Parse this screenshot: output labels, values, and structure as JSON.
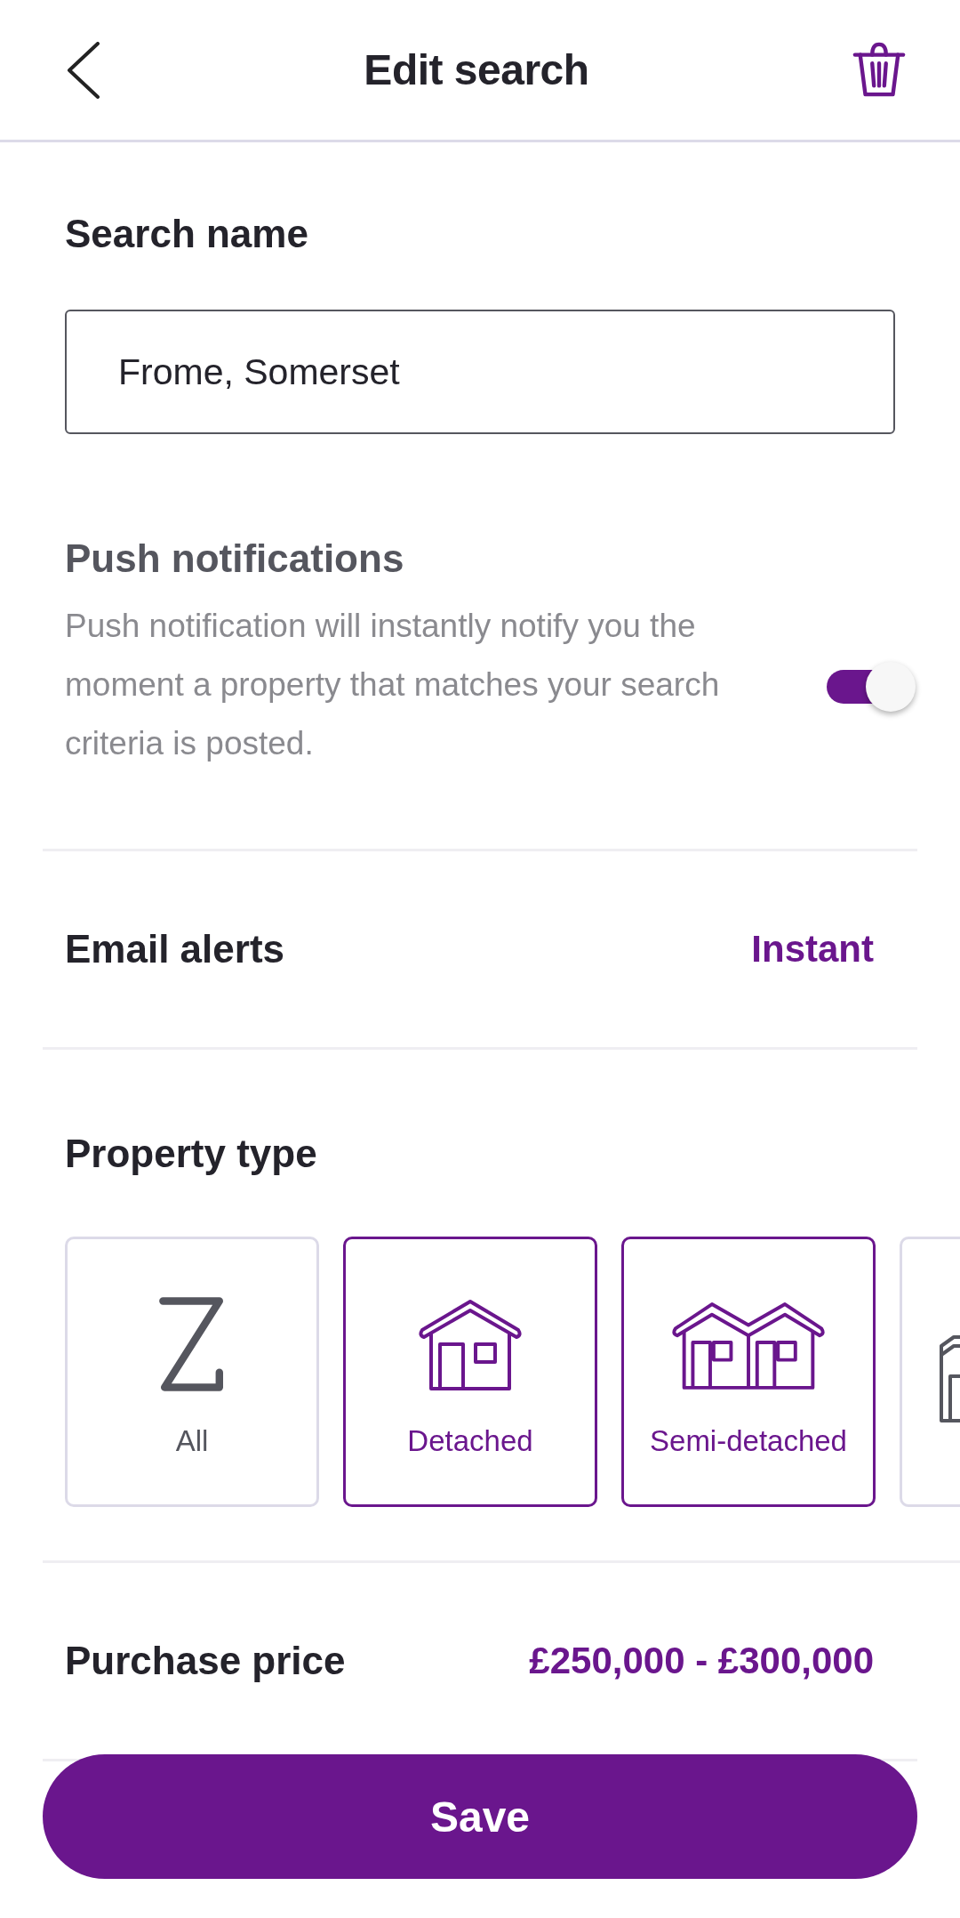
{
  "header": {
    "title": "Edit search"
  },
  "search_name": {
    "label": "Search name",
    "value": "Frome, Somerset"
  },
  "push_notifications": {
    "label": "Push notifications",
    "description": "Push notification will instantly notify you the moment a property that matches your search criteria is posted.",
    "on": true
  },
  "email_alerts": {
    "label": "Email alerts",
    "value": "Instant"
  },
  "property_type": {
    "label": "Property type",
    "options": [
      {
        "kind": "all",
        "label": "All",
        "selected": false
      },
      {
        "kind": "detached",
        "label": "Detached",
        "selected": true
      },
      {
        "kind": "semi",
        "label": "Semi-detached",
        "selected": true
      },
      {
        "kind": "terraced",
        "selected": false
      }
    ]
  },
  "purchase_price": {
    "label": "Purchase price",
    "value": "£250,000 - £300,000"
  },
  "save_button": {
    "label": "Save"
  }
}
